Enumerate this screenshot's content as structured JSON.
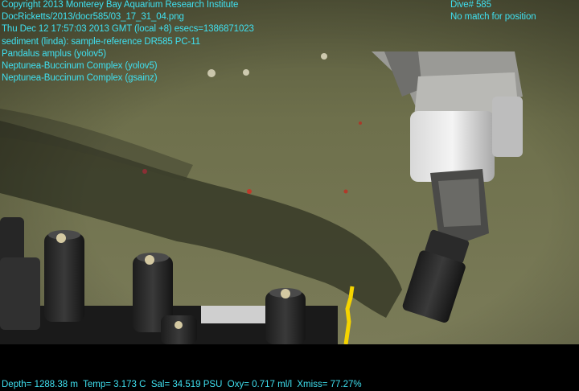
{
  "overlay": {
    "lines": [
      "Copyright 2013 Monterey Bay Aquarium Research Institute",
      "DocRicketts/2013/docr585/03_17_31_04.png",
      "Thu Dec 12 17:57:03 2013 GMT (local +8)  esecs=1386871023",
      "sediment (linda): sample-reference DR585 PC-11",
      "Pandalus amplus (yolov5)",
      "Neptunea-Buccinum Complex (yolov5)",
      "Neptunea-Buccinum Complex (gsainz)"
    ],
    "dive": "Dive# 585",
    "position_status": "No match for position"
  },
  "telemetry": {
    "depth": "Depth= 1288.38 m",
    "temp": "Temp= 3.173 C",
    "sal": "Sal= 34.519 PSU",
    "oxy": "Oxy= 0.717 ml/l",
    "xmiss": "Xmiss= 77.27%"
  },
  "colors": {
    "overlay_text": "#3fe0f0",
    "seafloor": "#6b6e4a",
    "shadow": "#2e3024"
  }
}
